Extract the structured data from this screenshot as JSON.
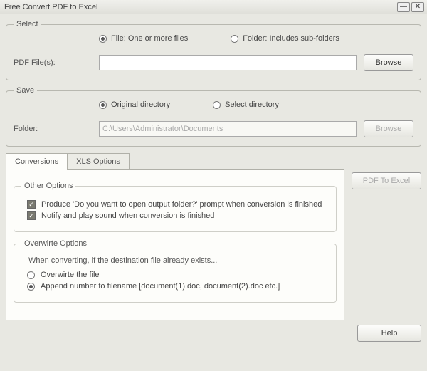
{
  "window": {
    "title": "Free Convert PDF to Excel"
  },
  "select": {
    "legend": "Select",
    "fileRadio": "File:  One or more files",
    "folderRadio": "Folder: Includes sub-folders",
    "pdfLabel": "PDF File(s):",
    "pdfValue": "",
    "browse": "Browse"
  },
  "save": {
    "legend": "Save",
    "originalRadio": "Original directory",
    "selectDirRadio": "Select directory",
    "folderLabel": "Folder:",
    "folderValue": "C:\\Users\\Administrator\\Documents",
    "browse": "Browse"
  },
  "tabs": {
    "conversions": "Conversions",
    "xls": "XLS Options"
  },
  "other": {
    "legend": "Other Options",
    "opt1": "Produce 'Do you want to open output folder?' prompt when conversion is finished",
    "opt2": "Notify and play sound when conversion is finished"
  },
  "overwrite": {
    "legend": "Overwirte Options",
    "desc": "When converting, if the destination file already exists...",
    "optOverwrite": "Overwirte the file",
    "optAppend": "Append number to filename  [document(1).doc, document(2).doc etc.]"
  },
  "actions": {
    "pdfToExcel": "PDF To Excel",
    "help": "Help"
  }
}
